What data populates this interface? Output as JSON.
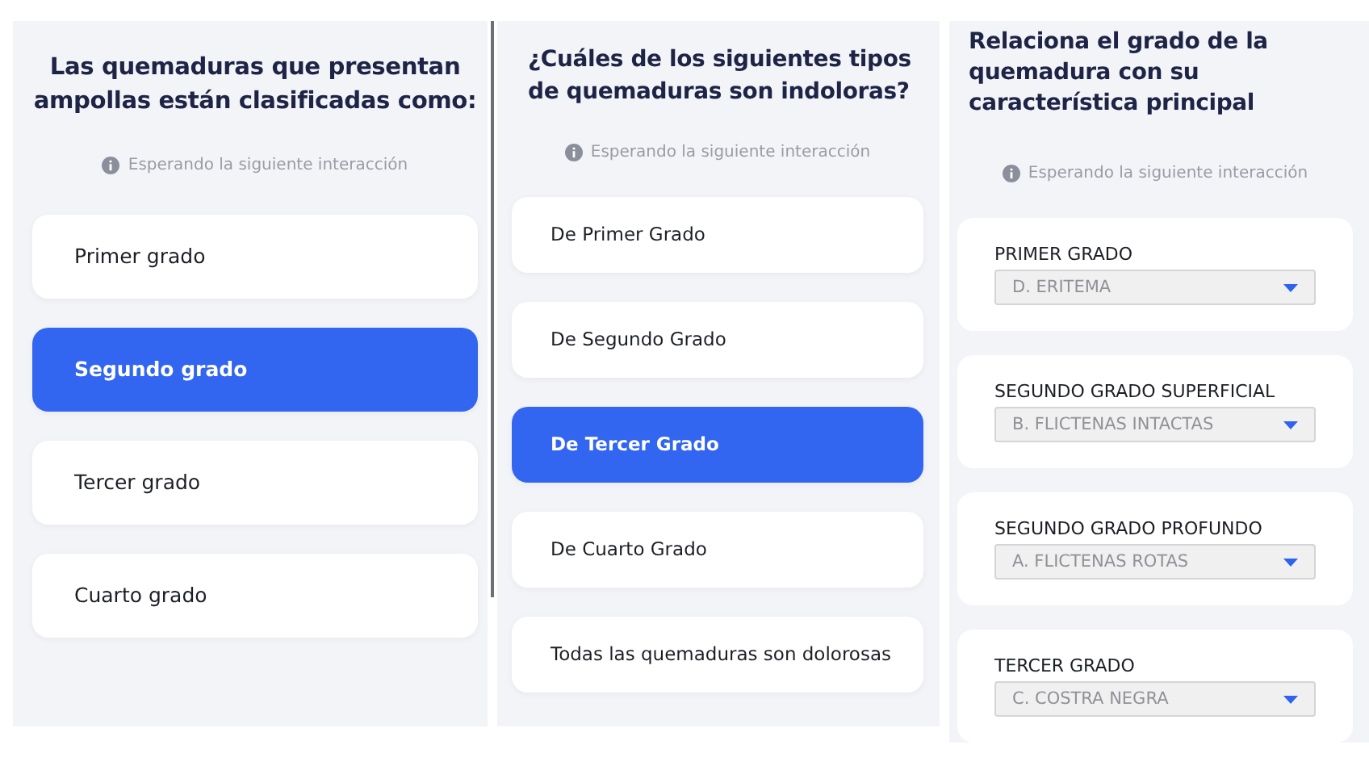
{
  "questions": [
    {
      "kind": "choice",
      "title": "Las quemaduras que presentan ampollas están clasificadas como:",
      "status": "Esperando la siguiente interacción",
      "options": [
        {
          "label": "Primer grado",
          "selected": false
        },
        {
          "label": "Segundo grado",
          "selected": true
        },
        {
          "label": "Tercer grado",
          "selected": false
        },
        {
          "label": "Cuarto grado",
          "selected": false
        }
      ]
    },
    {
      "kind": "choice",
      "title": "¿Cuáles de los siguientes tipos de quemaduras son indoloras?",
      "status": "Esperando la siguiente interacción",
      "options": [
        {
          "label": "De Primer Grado",
          "selected": false
        },
        {
          "label": "De Segundo Grado",
          "selected": false
        },
        {
          "label": "De Tercer Grado",
          "selected": true
        },
        {
          "label": "De Cuarto Grado",
          "selected": false
        },
        {
          "label": "Todas las quemaduras son dolorosas",
          "selected": false
        }
      ]
    },
    {
      "kind": "matching",
      "title": "Relaciona el grado de la quemadura con su característica principal",
      "status": "Esperando la siguiente interacción",
      "pairs": [
        {
          "label": "PRIMER GRADO",
          "value": "D. ERITEMA"
        },
        {
          "label": "SEGUNDO GRADO SUPERFICIAL",
          "value": "B. FLICTENAS INTACTAS"
        },
        {
          "label": "SEGUNDO GRADO PROFUNDO",
          "value": "A. FLICTENAS ROTAS"
        },
        {
          "label": "TERCER GRADO",
          "value": "C. COSTRA NEGRA"
        }
      ]
    }
  ]
}
